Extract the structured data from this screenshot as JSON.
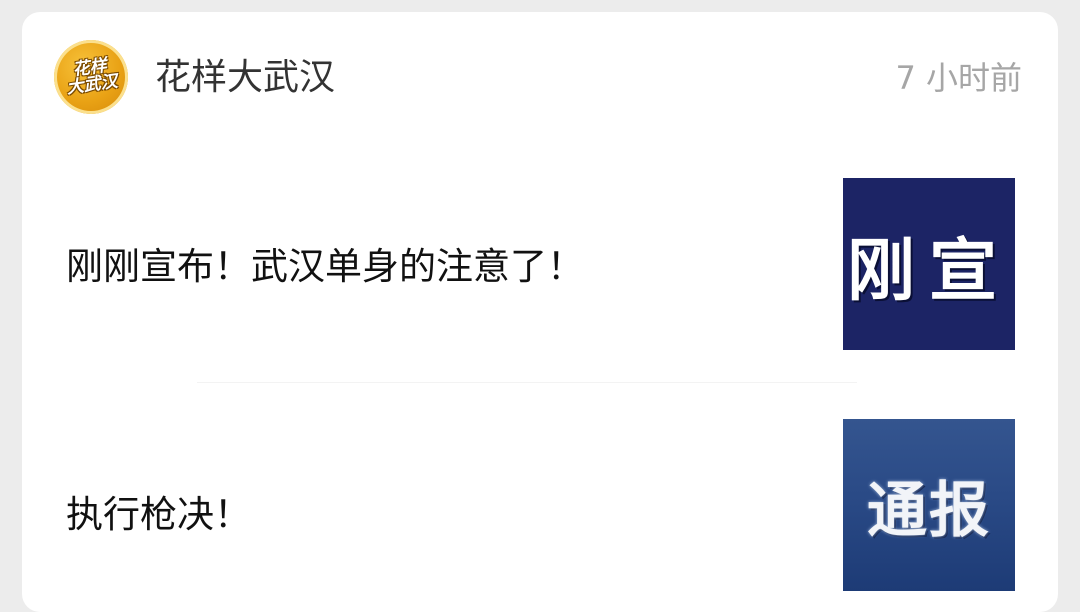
{
  "header": {
    "avatar_text_line1": "花样",
    "avatar_text_line2": "大武汉",
    "author_name": "花样大武汉",
    "timestamp": "7 小时前"
  },
  "articles": [
    {
      "title": "刚刚宣布！武汉单身的注意了！",
      "thumbnail_text": "刚宣"
    },
    {
      "title": "执行枪决！",
      "thumbnail_text": "通报"
    }
  ],
  "colors": {
    "thumbnail_1_bg": "#1c2465",
    "thumbnail_2_bg": "#2a4a86",
    "avatar_gold": "#e9a215"
  }
}
